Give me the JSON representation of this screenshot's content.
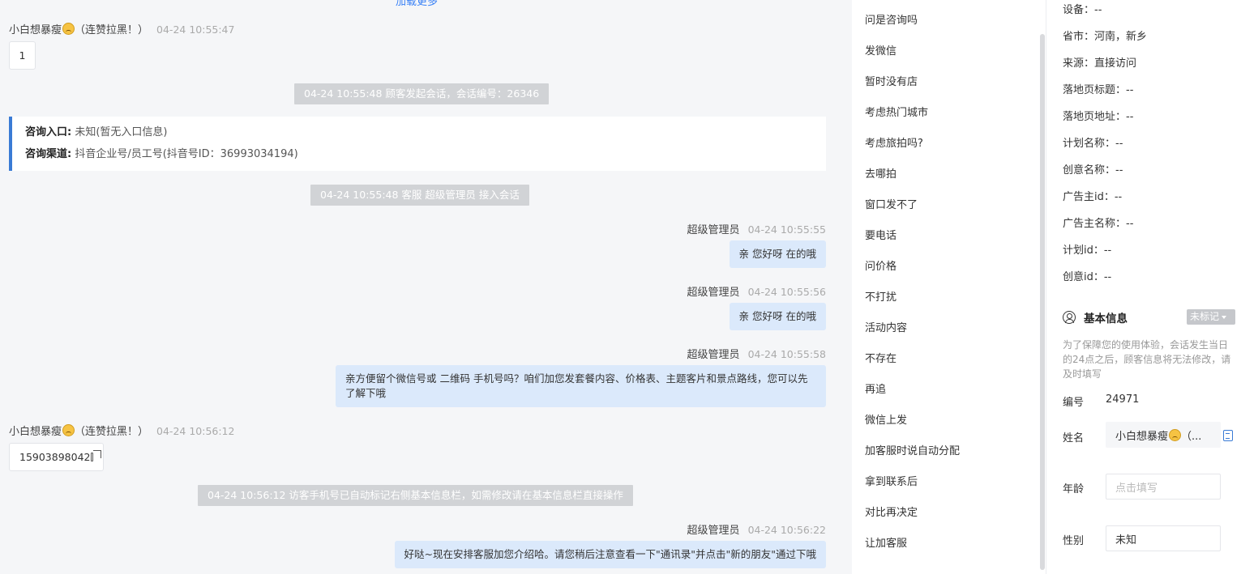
{
  "chat": {
    "top_link": "加载更多",
    "messages": [
      {
        "name": "小白想暴瘦",
        "suffix": "（连赞拉黑！）",
        "time": "04-24 10:55:47",
        "text": "1"
      },
      {
        "name": "小白想暴瘦",
        "suffix": "（连赞拉黑！）",
        "time": "04-24 10:56:12",
        "text": "15903898042"
      }
    ],
    "system": [
      "04-24 10:55:48 顾客发起会话，会话编号：26346",
      "04-24 10:55:48 客服 超级管理员 接入会话",
      "04-24 10:56:12 访客手机号已自动标记右侧基本信息栏，如需修改请在基本信息栏直接操作"
    ],
    "info_card": {
      "entry_label": "咨询入口:",
      "entry_value": "未知(暂无入口信息)",
      "channel_label": "咨询渠道:",
      "channel_value": "抖音企业号/员工号(抖音号ID：36993034194)"
    },
    "agent_messages": [
      {
        "name": "超级管理员",
        "time": "04-24 10:55:55",
        "text": "亲 您好呀 在的哦"
      },
      {
        "name": "超级管理员",
        "time": "04-24 10:55:56",
        "text": "亲 您好呀 在的哦"
      },
      {
        "name": "超级管理员",
        "time": "04-24 10:55:58",
        "text": "亲方便留个微信号或 二维码 手机号吗？咱们加您发套餐内容、价格表、主题客片和景点路线，您可以先了解下哦"
      },
      {
        "name": "超级管理员",
        "time": "04-24 10:56:22",
        "text": "好哒~现在安排客服加您介绍哈。请您稍后注意查看一下\"通讯录\"并点击\"新的朋友\"通过下哦"
      }
    ]
  },
  "quick_replies": [
    "问是咨询吗",
    "发微信",
    "暂时没有店",
    "考虑热门城市",
    "考虑旅拍吗?",
    "去哪拍",
    "窗口发不了",
    "要电话",
    "问价格",
    "不打扰",
    "活动内容",
    "不存在",
    "再追",
    "微信上发",
    "加客服时说自动分配",
    "拿到联系后",
    "对比再决定",
    "让加客服"
  ],
  "customer": {
    "attrs": [
      "设备：--",
      "省市：河南，新乡",
      "来源：直接访问",
      "落地页标题：--",
      "落地页地址：--",
      "计划名称：--",
      "创意名称：--",
      "广告主id：--",
      "广告主名称：--",
      "计划id：--",
      "创意id：--"
    ],
    "section_title": "基本信息",
    "tag_label": "未标记",
    "notice": "为了保障您的使用体验，会话发生当日的24点之后，顾客信息将无法修改，请及时填写",
    "id_label": "编号",
    "id_value": "24971",
    "name_label": "姓名",
    "name_value": "小白想暴瘦",
    "name_suffix": "（...",
    "age_label": "年龄",
    "age_placeholder": "点击填写",
    "gender_label": "性别",
    "gender_value": "未知"
  },
  "colors": {
    "accent": "#3a7bd5",
    "agent_bubble": "#dbe9fb",
    "system_bg": "#d1d3d6"
  }
}
